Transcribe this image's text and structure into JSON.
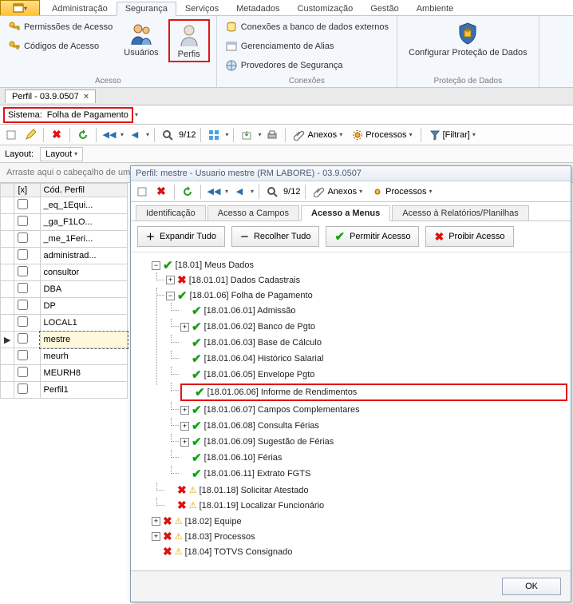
{
  "top_tabs": [
    "Administração",
    "Segurança",
    "Serviços",
    "Metadados",
    "Customização",
    "Gestão",
    "Ambiente"
  ],
  "active_top_tab": "Segurança",
  "ribbon": {
    "acesso": {
      "label": "Acesso",
      "perm": "Permissões de Acesso",
      "codigos": "Códigos de Acesso",
      "usuarios": "Usuários",
      "perfis": "Perfis"
    },
    "conexoes": {
      "label": "Conexões",
      "ext": "Conexões a banco de dados externos",
      "alias": "Gerenciamento de Alias",
      "prov": "Provedores de Segurança"
    },
    "protecao": {
      "label": "Proteção de Dados",
      "config": "Configurar Proteção de Dados"
    }
  },
  "doc_tab": "Perfil - 03.9.0507",
  "sistema": {
    "label": "Sistema:",
    "value": "Folha de Pagamento"
  },
  "toolbar": {
    "counter": "9/12",
    "anexos": "Anexos",
    "processos": "Processos",
    "filtrar": "[Filtrar]"
  },
  "layout": {
    "label": "Layout:",
    "btn": "Layout"
  },
  "grid": {
    "hint": "Arraste aqui o cabeçalho de uma coluna para agrupar",
    "col_x": "[x]",
    "col_code": "Cód. Perfil",
    "rows": [
      "_eq_1Equi...",
      "_ga_F1LO...",
      "_me_1Feri...",
      "administrad...",
      "consultor",
      "DBA",
      "DP",
      "LOCAL1",
      "mestre",
      "meurh",
      "MEURH8",
      "Perfil1"
    ],
    "selected": "mestre"
  },
  "dialog": {
    "title": "Perfil: mestre - Usuario mestre (RM LABORE) - 03.9.0507",
    "toolbar": {
      "counter": "9/12",
      "anexos": "Anexos",
      "processos": "Processos"
    },
    "tabs": [
      "Identificação",
      "Acesso a Campos",
      "Acesso a Menus",
      "Acesso à Relatórios/Planilhas"
    ],
    "active_tab": "Acesso a Menus",
    "actions": {
      "expand": "Expandir Tudo",
      "collapse": "Recolher Tudo",
      "permit": "Permitir Acesso",
      "deny": "Proibir Acesso"
    },
    "tree": {
      "n1801": "[18.01] Meus Dados",
      "n180101": "[18.01.01] Dados Cadastrais",
      "n180106": "[18.01.06] Folha de Pagamento",
      "n18010601": "[18.01.06.01] Admissão",
      "n18010602": "[18.01.06.02] Banco de Pgto",
      "n18010603": "[18.01.06.03] Base de Cálculo",
      "n18010604": "[18.01.06.04] Histórico Salarial",
      "n18010605": "[18.01.06.05] Envelope Pgto",
      "n18010606": "[18.01.06.06] Informe de Rendimentos",
      "n18010607": "[18.01.06.07] Campos Complementares",
      "n18010608": "[18.01.06.08] Consulta Férias",
      "n18010609": "[18.01.06.09] Sugestão de Férias",
      "n18010610": "[18.01.06.10] Férias",
      "n18010611": "[18.01.06.11] Extrato FGTS",
      "n180118": "[18.01.18] Solicitar Atestado",
      "n180119": "[18.01.19] Localizar Funcionário",
      "n1802": "[18.02] Equipe",
      "n1803": "[18.03] Processos",
      "n1804": "[18.04] TOTVS Consignado"
    },
    "ok": "OK"
  }
}
